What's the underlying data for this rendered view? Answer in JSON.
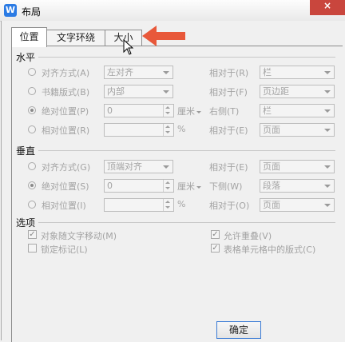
{
  "window": {
    "title": "布局",
    "close_label": "×",
    "app_icon": "W"
  },
  "tabs": [
    {
      "label": "位置",
      "active": true
    },
    {
      "label": "文字环绕",
      "active": false
    },
    {
      "label": "大小",
      "active": false
    }
  ],
  "horizontal": {
    "title": "水平",
    "rows": [
      {
        "label": "对齐方式(A)",
        "value": "左对齐",
        "rel_label": "相对于(R)",
        "rel_value": "栏",
        "checked": false
      },
      {
        "label": "书籍版式(B)",
        "value": "内部",
        "rel_label": "相对于(F)",
        "rel_value": "页边距",
        "checked": false
      },
      {
        "label": "绝对位置(P)",
        "value": "0",
        "unit": "厘米",
        "rel_label": "右侧(T)",
        "rel_value": "栏",
        "checked": true
      },
      {
        "label": "相对位置(R)",
        "value": "",
        "unit": "%",
        "rel_label": "相对于(E)",
        "rel_value": "页面",
        "checked": false
      }
    ]
  },
  "vertical": {
    "title": "垂直",
    "rows": [
      {
        "label": "对齐方式(G)",
        "value": "顶端对齐",
        "rel_label": "相对于(E)",
        "rel_value": "页面",
        "checked": false
      },
      {
        "label": "绝对位置(S)",
        "value": "0",
        "unit": "厘米",
        "rel_label": "下侧(W)",
        "rel_value": "段落",
        "checked": true
      },
      {
        "label": "相对位置(I)",
        "value": "",
        "unit": "%",
        "rel_label": "相对于(O)",
        "rel_value": "页面",
        "checked": false
      }
    ]
  },
  "options": {
    "title": "选项",
    "items": [
      {
        "label": "对象随文字移动(M)",
        "checked": true
      },
      {
        "label": "锁定标记(L)",
        "checked": false
      },
      {
        "label": "允许重叠(V)",
        "checked": true
      },
      {
        "label": "表格单元格中的版式(C)",
        "checked": true
      }
    ]
  },
  "buttons": {
    "ok": "确定"
  },
  "check_mark": "✓",
  "colors": {
    "arrow": "#e8583a",
    "close": "#c9463d",
    "ok_border": "#3a7bd5"
  }
}
